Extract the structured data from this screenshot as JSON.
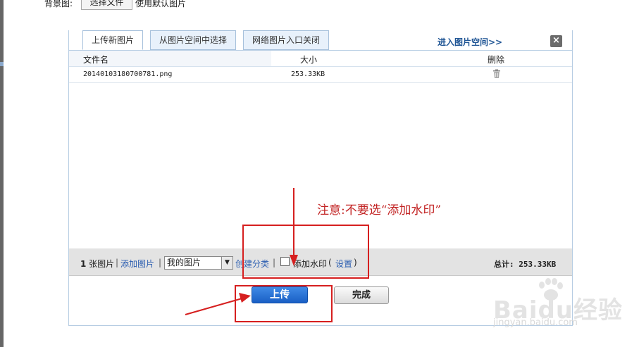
{
  "topbar": {
    "background_label": "背景图:",
    "choose_file_label": "选择文件",
    "use_default_label": "使用默认图片"
  },
  "tabs": [
    {
      "label": "上传新图片",
      "active": true
    },
    {
      "label": "从图片空间中选择",
      "active": false
    },
    {
      "label": "网络图片入口关闭",
      "active": false
    }
  ],
  "header": {
    "enter_space_label": "进入图片空间>>",
    "close_label": "×"
  },
  "table": {
    "columns": [
      "文件名",
      "大小",
      "删除"
    ],
    "rows": [
      {
        "name": "20140103180700781.png",
        "size": "253.33KB"
      }
    ]
  },
  "footer": {
    "count_number": "1",
    "count_suffix": " 张图片",
    "separator": "|",
    "add_image_label": "添加图片",
    "album_select_value": "我的图片",
    "create_category_label": "创建分类",
    "watermark_label": "添加水印",
    "settings_open": "(",
    "settings_label": "设置",
    "settings_close": ")",
    "total_label": "总计: 253.33KB"
  },
  "actions": {
    "upload_label": "上传",
    "done_label": "完成"
  },
  "annotation": {
    "note_text": "注意:不要选“添加水印”"
  },
  "watermark": {
    "logo_text": "Baidu经验",
    "url_text": "jingyan.baidu.com"
  },
  "colors": {
    "link": "#2a5db0",
    "accent": "#1a5fc5",
    "annotation_red": "#d61f1f"
  }
}
